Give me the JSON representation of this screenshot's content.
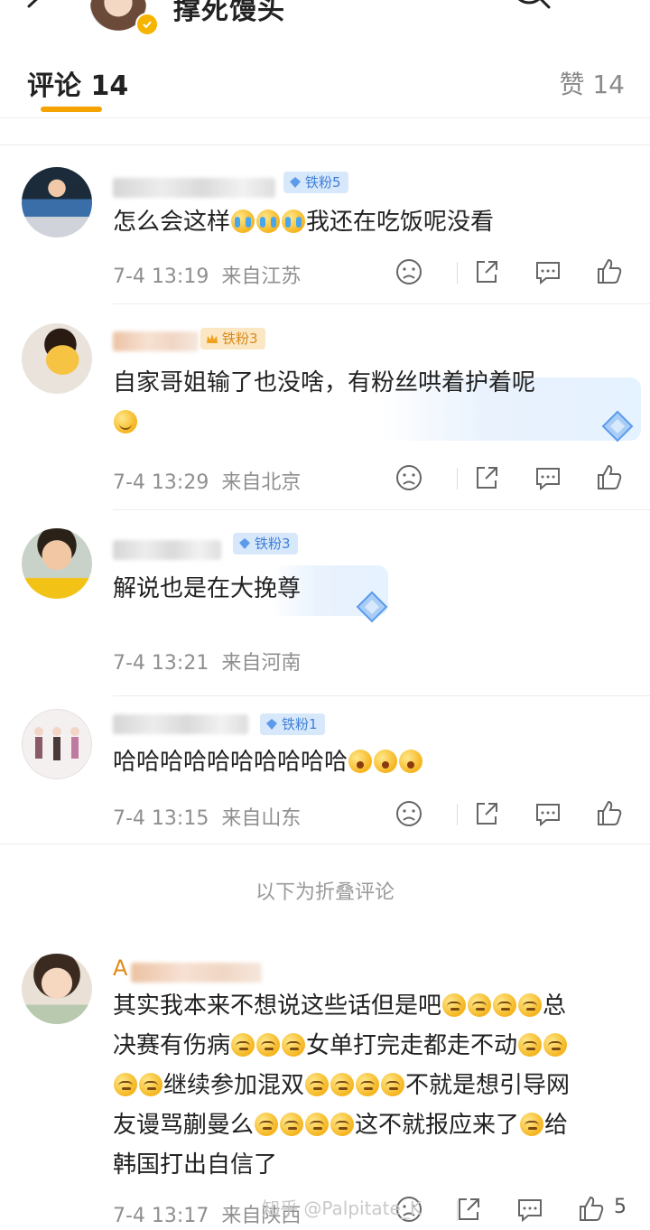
{
  "header": {
    "title": "撑死馒头"
  },
  "tabs": {
    "comments_label": "评论 14",
    "likes_label": "赞 14"
  },
  "comments": [
    {
      "badge": "铁粉5",
      "text_before": "怎么会这样",
      "text_after": "我还在吃饭呢没看",
      "time": "7-4 13:19",
      "location": "来自江苏"
    },
    {
      "badge": "铁粉3",
      "text": "自家哥姐输了也没啥，有粉丝哄着护着呢",
      "time": "7-4 13:29",
      "location": "来自北京"
    },
    {
      "badge": "铁粉3",
      "text": "解说也是在大挽尊",
      "time": "7-4 13:21",
      "location": "来自河南"
    },
    {
      "badge": "铁粉1",
      "text": "哈哈哈哈哈哈哈哈哈哈",
      "time": "7-4 13:15",
      "location": "来自山东"
    }
  ],
  "folded": {
    "label": "以下为折叠评论",
    "comment": {
      "name_prefix": "A",
      "lines": {
        "l1a": "其实我本来不想说这些话但是吧",
        "l1b": "总",
        "l2a": "决赛有伤病",
        "l2b": "女单打完走都走不动",
        "l3a": "继续参加混双",
        "l3b": "不就是想引导网",
        "l4a": "友谩骂蒯曼么",
        "l4b": "这不就报应来了",
        "l4c": "给",
        "l5": "韩国打出自信了"
      },
      "time": "7-4 13:17",
      "location": "来自陕西",
      "like_count": "5"
    }
  },
  "watermark": "知乎 @Palpitate_K"
}
